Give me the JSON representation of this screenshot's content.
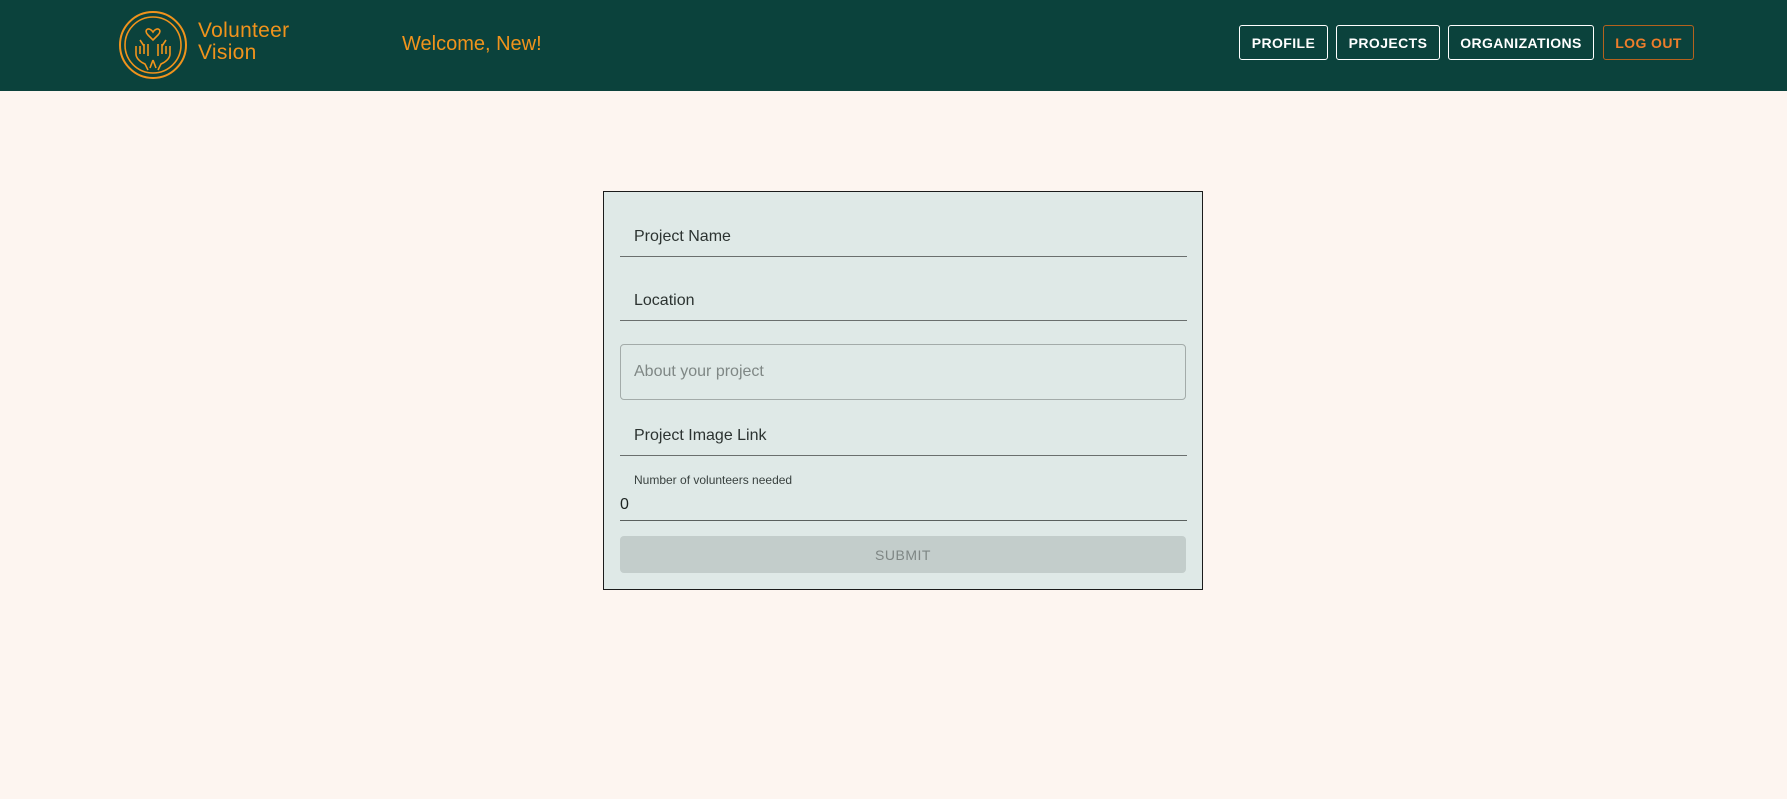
{
  "brand": {
    "name_line1": "Volunteer",
    "name_line2": "Vision",
    "logo_icon": "hands-heart-logo-icon"
  },
  "header": {
    "welcome": "Welcome, New!"
  },
  "nav": {
    "profile": "PROFILE",
    "projects": "PROJECTS",
    "organizations": "ORGANIZATIONS",
    "logout": "LOG OUT"
  },
  "form": {
    "project_name_label": "Project Name",
    "location_label": "Location",
    "about_placeholder": "About your project",
    "image_link_label": "Project Image Link",
    "volunteers_label": "Number of volunteers needed",
    "volunteers_value": "0",
    "submit_label": "SUBMIT"
  },
  "colors": {
    "header_bg": "#0b423c",
    "accent": "#f0931c",
    "page_bg": "#fdf5f0",
    "card_bg": "#dfe9e7",
    "logout": "#ee7d2b"
  }
}
